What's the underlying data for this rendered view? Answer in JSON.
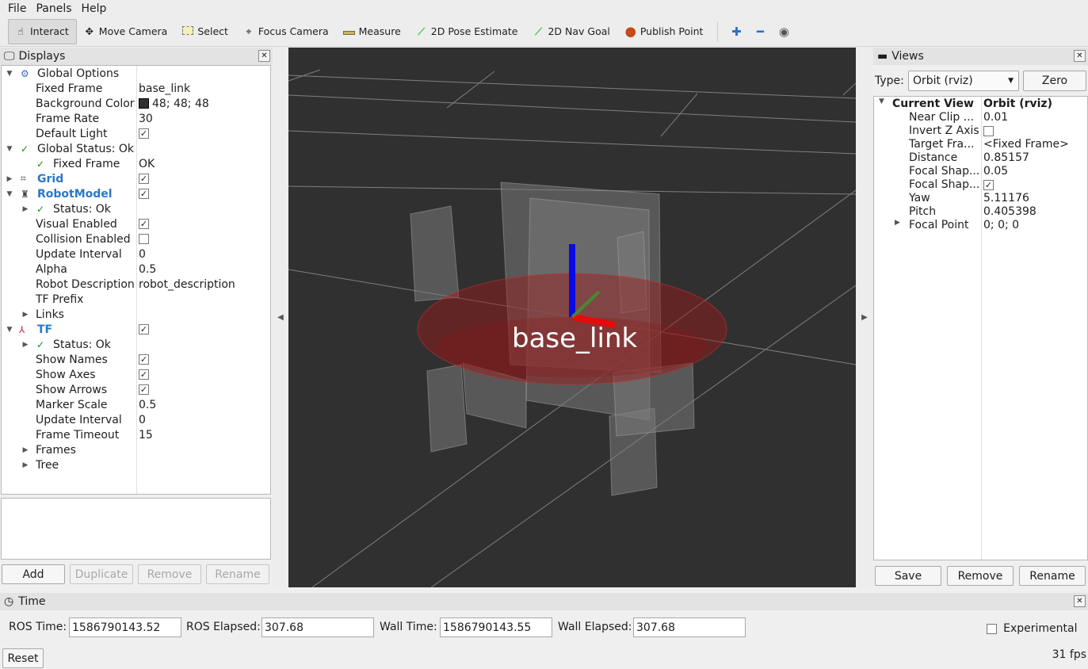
{
  "menubar": {
    "items": [
      "File",
      "Panels",
      "Help"
    ]
  },
  "toolbar": {
    "tools": [
      {
        "label": "Interact",
        "icon": "hand-pointer-icon"
      },
      {
        "label": "Move Camera",
        "icon": "move-camera-icon"
      },
      {
        "label": "Select",
        "icon": "select-box-icon"
      },
      {
        "label": "Focus Camera",
        "icon": "focus-camera-icon"
      },
      {
        "label": "Measure",
        "icon": "ruler-icon"
      },
      {
        "label": "2D Pose Estimate",
        "icon": "green-arrow-icon"
      },
      {
        "label": "2D Nav Goal",
        "icon": "green-arrow-icon"
      },
      {
        "label": "Publish Point",
        "icon": "map-pin-icon"
      }
    ],
    "active_tool": "Interact"
  },
  "displays": {
    "title": "Displays",
    "rows": [
      {
        "name": "Global Options",
        "value": ""
      },
      {
        "name": "Fixed Frame",
        "value": "base_link"
      },
      {
        "name": "Background Color",
        "value": "48; 48; 48"
      },
      {
        "name": "Frame Rate",
        "value": "30"
      },
      {
        "name": "Default Light",
        "value": ""
      },
      {
        "name": "Global Status: Ok",
        "value": ""
      },
      {
        "name": "Fixed Frame",
        "value": "OK"
      },
      {
        "name": "Grid",
        "value": ""
      },
      {
        "name": "RobotModel",
        "value": ""
      },
      {
        "name": "Status: Ok",
        "value": ""
      },
      {
        "name": "Visual Enabled",
        "value": ""
      },
      {
        "name": "Collision Enabled",
        "value": ""
      },
      {
        "name": "Update Interval",
        "value": "0"
      },
      {
        "name": "Alpha",
        "value": "0.5"
      },
      {
        "name": "Robot Description",
        "value": "robot_description"
      },
      {
        "name": "TF Prefix",
        "value": ""
      },
      {
        "name": "Links",
        "value": ""
      },
      {
        "name": "TF",
        "value": ""
      },
      {
        "name": "Status: Ok",
        "value": ""
      },
      {
        "name": "Show Names",
        "value": ""
      },
      {
        "name": "Show Axes",
        "value": ""
      },
      {
        "name": "Show Arrows",
        "value": ""
      },
      {
        "name": "Marker Scale",
        "value": "0.5"
      },
      {
        "name": "Update Interval",
        "value": "0"
      },
      {
        "name": "Frame Timeout",
        "value": "15"
      },
      {
        "name": "Frames",
        "value": ""
      },
      {
        "name": "Tree",
        "value": ""
      }
    ],
    "buttons": {
      "add": "Add",
      "duplicate": "Duplicate",
      "remove": "Remove",
      "rename": "Rename"
    }
  },
  "scene": {
    "frame_label": "base_link",
    "background_color": "#303030"
  },
  "views": {
    "title": "Views",
    "type_label": "Type:",
    "type_value": "Orbit (rviz)",
    "zero_label": "Zero",
    "current_view": {
      "name": "Current View",
      "value": "Orbit (rviz)"
    },
    "props": [
      {
        "name": "Near Clip ...",
        "value": "0.01"
      },
      {
        "name": "Invert Z Axis",
        "value": ""
      },
      {
        "name": "Target Fra...",
        "value": "<Fixed Frame>"
      },
      {
        "name": "Distance",
        "value": "0.85157"
      },
      {
        "name": "Focal Shap...",
        "value": "0.05"
      },
      {
        "name": "Focal Shap...",
        "value": ""
      },
      {
        "name": "Yaw",
        "value": "5.11176"
      },
      {
        "name": "Pitch",
        "value": "0.405398"
      },
      {
        "name": "Focal Point",
        "value": "0; 0; 0"
      }
    ],
    "buttons": {
      "save": "Save",
      "remove": "Remove",
      "rename": "Rename"
    }
  },
  "time": {
    "title": "Time",
    "ros_time_label": "ROS Time:",
    "ros_time": "1586790143.52",
    "ros_elapsed_label": "ROS Elapsed:",
    "ros_elapsed": "307.68",
    "wall_time_label": "Wall Time:",
    "wall_time": "1586790143.55",
    "wall_elapsed_label": "Wall Elapsed:",
    "wall_elapsed": "307.68",
    "experimental_label": "Experimental",
    "reset_label": "Reset",
    "fps": "31 fps"
  }
}
